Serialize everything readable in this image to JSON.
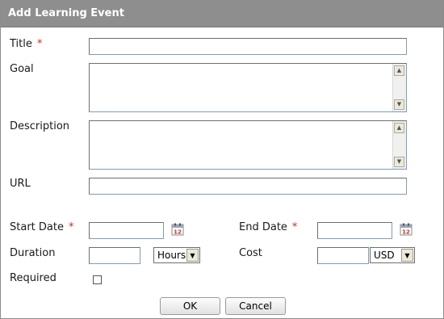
{
  "dialog": {
    "title": "Add Learning Event",
    "ok_label": "OK",
    "cancel_label": "Cancel"
  },
  "fields": {
    "title": {
      "label": "Title",
      "required_mark": "*",
      "value": ""
    },
    "goal": {
      "label": "Goal",
      "value": ""
    },
    "description": {
      "label": "Description",
      "value": ""
    },
    "url": {
      "label": "URL",
      "value": ""
    },
    "start_date": {
      "label": "Start Date",
      "required_mark": "*",
      "value": "",
      "calendar_day": "12"
    },
    "end_date": {
      "label": "End Date",
      "required_mark": "*",
      "value": "",
      "calendar_day": "12"
    },
    "duration": {
      "label": "Duration",
      "value": "",
      "unit_selected": "Hours"
    },
    "cost": {
      "label": "Cost",
      "value": "",
      "currency_selected": "USD"
    },
    "required": {
      "label": "Required",
      "checked": false
    }
  },
  "icons": {
    "calendar": "calendar-icon",
    "scroll_up": "scroll-up-arrow-icon",
    "scroll_down": "scroll-down-arrow-icon",
    "dropdown": "chevron-down-icon"
  },
  "colors": {
    "titlebar": "#8e8e8e",
    "required_mark": "#d42a1c"
  }
}
